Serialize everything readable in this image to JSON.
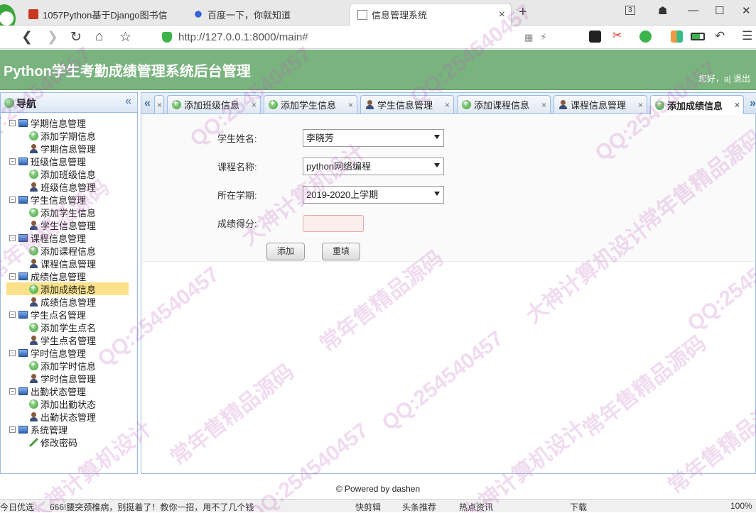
{
  "browser": {
    "tabs": [
      {
        "title": "1057Python基于Django图书信",
        "icon": "book-icon",
        "close": ""
      },
      {
        "title": "百度一下，你就知道",
        "icon": "baidu-paw-icon",
        "close": ""
      },
      {
        "title": "信息管理系统",
        "icon": "document-icon",
        "close": "×"
      }
    ],
    "new_tab": "+",
    "tab_count": "3",
    "url": "http://127.0.0.1:8000/main#"
  },
  "app": {
    "title": "Python学生考勤成绩管理系统后台管理",
    "user_links": "您好，a| 退出"
  },
  "sidebar": {
    "title": "导航",
    "collapse": "«",
    "groups": [
      {
        "label": "学期信息管理",
        "items": [
          {
            "label": "添加学期信息",
            "icon": "add-icon"
          },
          {
            "label": "学期信息管理",
            "icon": "user-icon"
          }
        ]
      },
      {
        "label": "班级信息管理",
        "items": [
          {
            "label": "添加班级信息",
            "icon": "add-icon"
          },
          {
            "label": "班级信息管理",
            "icon": "user-icon"
          }
        ]
      },
      {
        "label": "学生信息管理",
        "items": [
          {
            "label": "添加学生信息",
            "icon": "add-icon"
          },
          {
            "label": "学生信息管理",
            "icon": "user-icon"
          }
        ]
      },
      {
        "label": "课程信息管理",
        "items": [
          {
            "label": "添加课程信息",
            "icon": "add-icon"
          },
          {
            "label": "课程信息管理",
            "icon": "user-icon"
          }
        ]
      },
      {
        "label": "成绩信息管理",
        "items": [
          {
            "label": "添加成绩信息",
            "icon": "add-icon",
            "active": true
          },
          {
            "label": "成绩信息管理",
            "icon": "user-icon"
          }
        ]
      },
      {
        "label": "学生点名管理",
        "items": [
          {
            "label": "添加学生点名",
            "icon": "add-icon"
          },
          {
            "label": "学生点名管理",
            "icon": "user-icon"
          }
        ]
      },
      {
        "label": "学时信息管理",
        "items": [
          {
            "label": "添加学时信息",
            "icon": "add-icon"
          },
          {
            "label": "学时信息管理",
            "icon": "user-icon"
          }
        ]
      },
      {
        "label": "出勤状态管理",
        "items": [
          {
            "label": "添加出勤状态",
            "icon": "add-icon"
          },
          {
            "label": "出勤状态管理",
            "icon": "user-icon"
          }
        ]
      },
      {
        "label": "系统管理",
        "items": [
          {
            "label": "修改密码",
            "icon": "pencil-icon"
          }
        ]
      }
    ]
  },
  "tabs": [
    {
      "label": "添加班级信息",
      "icon": "add-icon"
    },
    {
      "label": "添加学生信息",
      "icon": "add-icon"
    },
    {
      "label": "学生信息管理",
      "icon": "user-icon"
    },
    {
      "label": "添加课程信息",
      "icon": "add-icon"
    },
    {
      "label": "课程信息管理",
      "icon": "user-icon"
    },
    {
      "label": "添加成绩信息",
      "icon": "add-icon",
      "active": true
    }
  ],
  "tab_close": "×",
  "form": {
    "student_label": "学生姓名:",
    "student_value": "李晓芳",
    "course_label": "课程名称:",
    "course_value": "python网络编程",
    "term_label": "所在学期:",
    "term_value": "2019-2020上学期",
    "score_label": "成绩得分:",
    "score_value": "",
    "add_button": "添加",
    "reset_button": "重填"
  },
  "footer": "© Powered by dashen",
  "statusbar": {
    "left": "今日优选",
    "news": "666!腰突颈椎病，别挺着了！教你一招，用不了几个钱",
    "items": [
      "快剪辑",
      "头条推荐",
      "热点资讯",
      "下载"
    ],
    "zoom": "100%"
  },
  "watermark": [
    "QQ:254540457",
    "常年售精品源码",
    "大神计算机设计"
  ]
}
